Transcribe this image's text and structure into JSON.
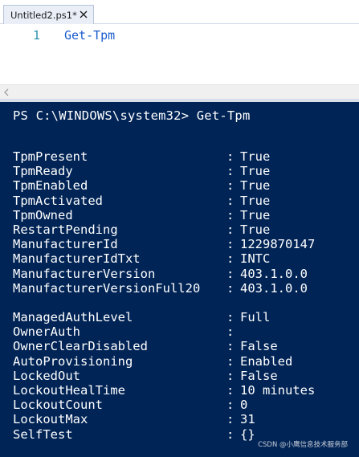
{
  "tab": {
    "label": "Untitled2.ps1*"
  },
  "editor": {
    "line_number": "1",
    "code": "Get-Tpm"
  },
  "console": {
    "prompt": "PS C:\\WINDOWS\\system32> Get-Tpm",
    "separator": ":",
    "group1": [
      {
        "name": "TpmPresent",
        "value": "True"
      },
      {
        "name": "TpmReady",
        "value": "True"
      },
      {
        "name": "TpmEnabled",
        "value": "True"
      },
      {
        "name": "TpmActivated",
        "value": "True"
      },
      {
        "name": "TpmOwned",
        "value": "True"
      },
      {
        "name": "RestartPending",
        "value": "True"
      },
      {
        "name": "ManufacturerId",
        "value": "1229870147"
      },
      {
        "name": "ManufacturerIdTxt",
        "value": "INTC"
      },
      {
        "name": "ManufacturerVersion",
        "value": "403.1.0.0"
      },
      {
        "name": "ManufacturerVersionFull20",
        "value": "403.1.0.0"
      }
    ],
    "group2": [
      {
        "name": "ManagedAuthLevel",
        "value": "Full"
      },
      {
        "name": "OwnerAuth",
        "value": ""
      },
      {
        "name": "OwnerClearDisabled",
        "value": "False"
      },
      {
        "name": "AutoProvisioning",
        "value": "Enabled"
      },
      {
        "name": "LockedOut",
        "value": "False"
      },
      {
        "name": "LockoutHealTime",
        "value": "10 minutes"
      },
      {
        "name": "LockoutCount",
        "value": "0"
      },
      {
        "name": "LockoutMax",
        "value": "31"
      },
      {
        "name": "SelfTest",
        "value": "{}"
      }
    ]
  },
  "watermark": "CSDN @小鹰信息技术服务部",
  "colors": {
    "console_bg": "#012456",
    "console_text": "#ffffff",
    "code_text": "#1a5ccc",
    "line_number": "#2b91af"
  },
  "icons": {
    "tab_close": "close-icon",
    "scroll_left": "chevron-left-icon"
  }
}
